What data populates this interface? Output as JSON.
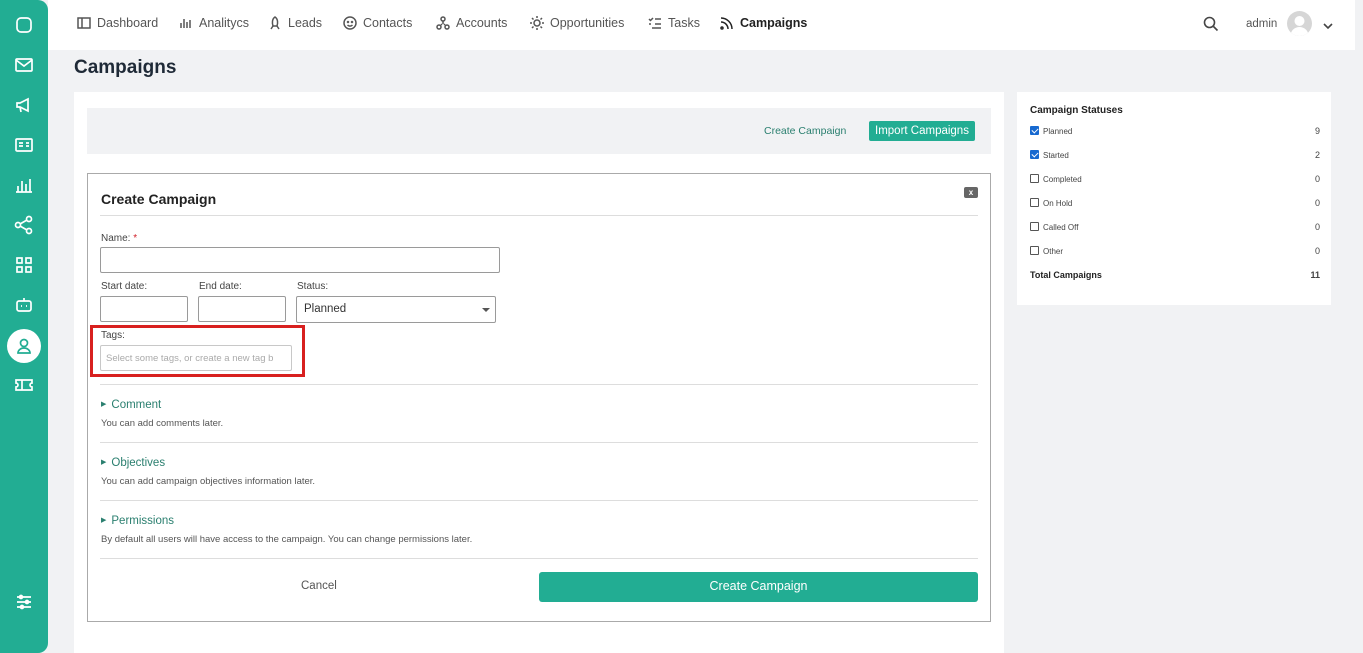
{
  "nav": {
    "items": [
      {
        "label": "Dashboard",
        "icon": "dashboard-icon"
      },
      {
        "label": "Analitycs",
        "icon": "analytics-icon"
      },
      {
        "label": "Leads",
        "icon": "leads-icon"
      },
      {
        "label": "Contacts",
        "icon": "contacts-icon"
      },
      {
        "label": "Accounts",
        "icon": "accounts-icon"
      },
      {
        "label": "Opportunities",
        "icon": "opportunities-icon"
      },
      {
        "label": "Tasks",
        "icon": "tasks-icon"
      },
      {
        "label": "Campaigns",
        "icon": "campaigns-icon"
      }
    ],
    "active": "Campaigns",
    "user": "admin"
  },
  "page": {
    "title": "Campaigns"
  },
  "toolbar": {
    "create_link": "Create Campaign",
    "import_button": "Import Campaigns"
  },
  "form": {
    "title": "Create Campaign",
    "close": "x",
    "name_label": "Name:",
    "name_value": "",
    "start_label": "Start date:",
    "end_label": "End date:",
    "status_label": "Status:",
    "status_value": "Planned",
    "tags_label": "Tags:",
    "tags_placeholder": "Select some tags, or create a new tag b",
    "sections": [
      {
        "title": "Comment",
        "desc": "You can add comments later."
      },
      {
        "title": "Objectives",
        "desc": "You can add campaign objectives information later."
      },
      {
        "title": "Permissions",
        "desc": "By default all users will have access to the campaign. You can change permissions later."
      }
    ],
    "cancel": "Cancel",
    "submit": "Create Campaign"
  },
  "statuses": {
    "title": "Campaign Statuses",
    "items": [
      {
        "label": "Planned",
        "count": "9",
        "checked": true
      },
      {
        "label": "Started",
        "count": "2",
        "checked": true
      },
      {
        "label": "Completed",
        "count": "0",
        "checked": false
      },
      {
        "label": "On Hold",
        "count": "0",
        "checked": false
      },
      {
        "label": "Called Off",
        "count": "0",
        "checked": false
      },
      {
        "label": "Other",
        "count": "0",
        "checked": false
      }
    ],
    "total_label": "Total Campaigns",
    "total_count": "11"
  },
  "colors": {
    "accent": "#22ad93",
    "highlight": "#d8201f"
  }
}
